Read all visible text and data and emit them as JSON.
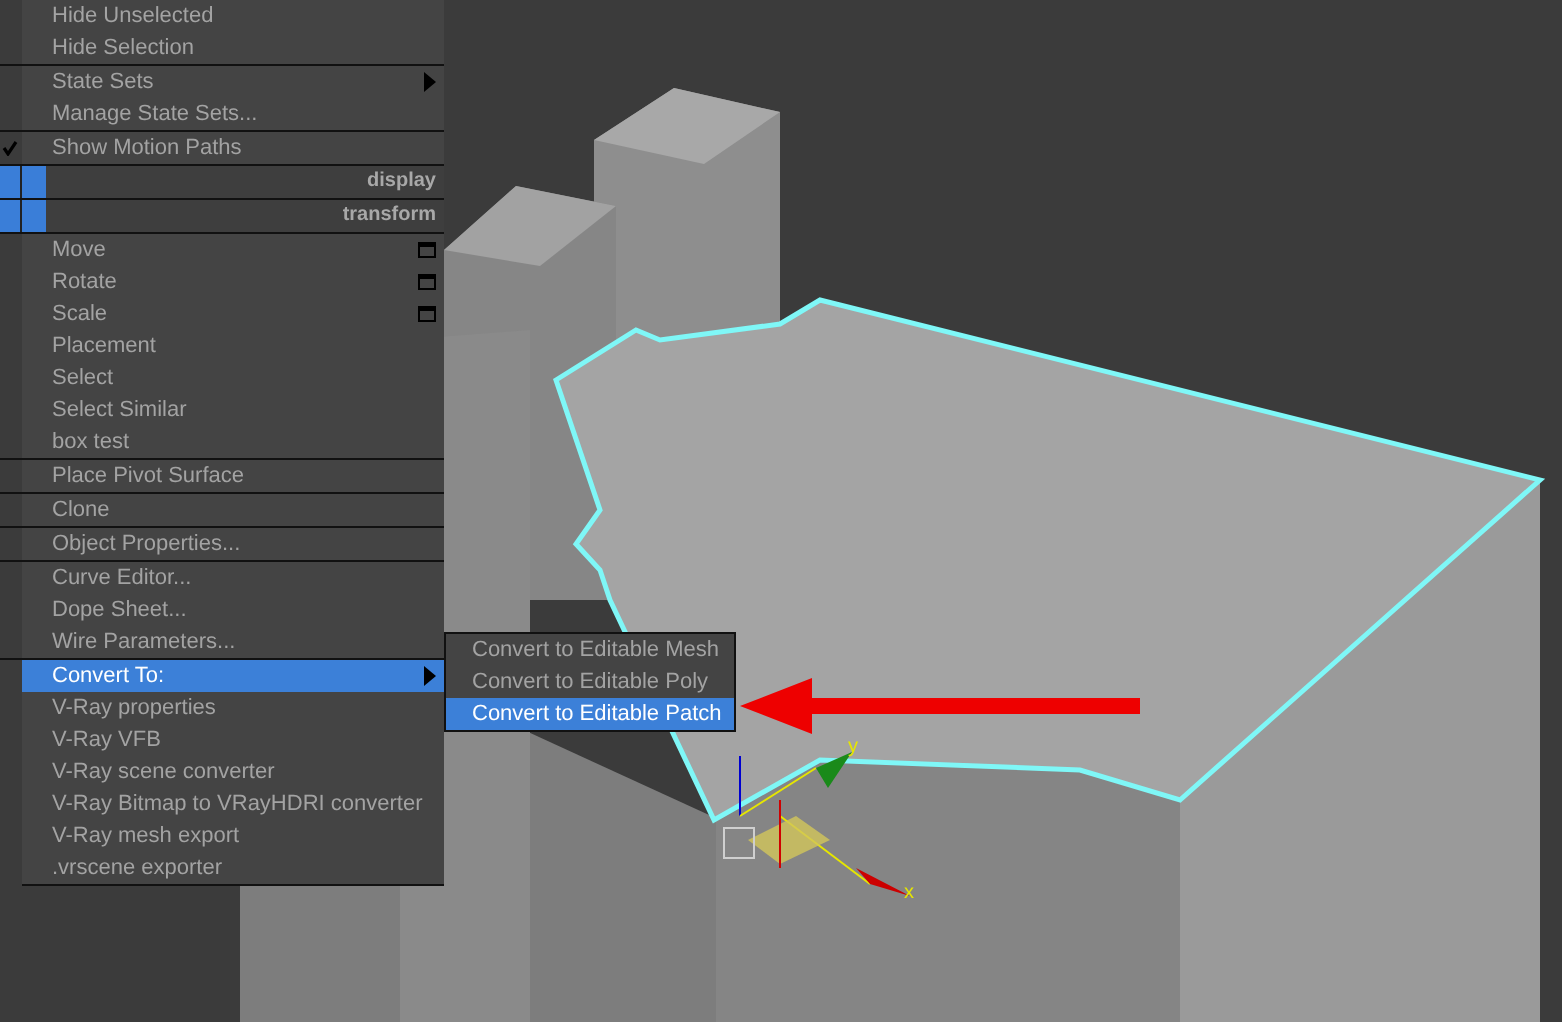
{
  "context_menu": {
    "groups": [
      {
        "items": [
          {
            "kind": "item",
            "label": "Hide Unselected",
            "has_submenu": false,
            "checked": false,
            "selected": false,
            "window_icon": false
          },
          {
            "kind": "item",
            "label": "Hide Selection",
            "has_submenu": false,
            "checked": false,
            "selected": false,
            "window_icon": false
          }
        ]
      },
      {
        "items": [
          {
            "kind": "item",
            "label": "State Sets",
            "has_submenu": true,
            "checked": false,
            "selected": false,
            "window_icon": false
          },
          {
            "kind": "item",
            "label": "Manage State Sets...",
            "has_submenu": false,
            "checked": false,
            "selected": false,
            "window_icon": false
          }
        ]
      },
      {
        "items": [
          {
            "kind": "item",
            "label": "Show Motion Paths",
            "has_submenu": false,
            "checked": true,
            "selected": false,
            "window_icon": false
          }
        ]
      },
      {
        "items": [
          {
            "kind": "header",
            "label": "display"
          }
        ]
      },
      {
        "items": [
          {
            "kind": "header",
            "label": "transform"
          }
        ]
      },
      {
        "items": [
          {
            "kind": "item",
            "label": "Move",
            "has_submenu": false,
            "checked": false,
            "selected": false,
            "window_icon": true
          },
          {
            "kind": "item",
            "label": "Rotate",
            "has_submenu": false,
            "checked": false,
            "selected": false,
            "window_icon": true
          },
          {
            "kind": "item",
            "label": "Scale",
            "has_submenu": false,
            "checked": false,
            "selected": false,
            "window_icon": true
          },
          {
            "kind": "item",
            "label": "Placement",
            "has_submenu": false,
            "checked": false,
            "selected": false,
            "window_icon": false
          },
          {
            "kind": "item",
            "label": "Select",
            "has_submenu": false,
            "checked": false,
            "selected": false,
            "window_icon": false
          },
          {
            "kind": "item",
            "label": "Select Similar",
            "has_submenu": false,
            "checked": false,
            "selected": false,
            "window_icon": false
          },
          {
            "kind": "item",
            "label": "box test",
            "has_submenu": false,
            "checked": false,
            "selected": false,
            "window_icon": false
          }
        ]
      },
      {
        "items": [
          {
            "kind": "item",
            "label": "Place Pivot Surface",
            "has_submenu": false,
            "checked": false,
            "selected": false,
            "window_icon": false
          }
        ]
      },
      {
        "items": [
          {
            "kind": "item",
            "label": "Clone",
            "has_submenu": false,
            "checked": false,
            "selected": false,
            "window_icon": false
          }
        ]
      },
      {
        "items": [
          {
            "kind": "item",
            "label": "Object Properties...",
            "has_submenu": false,
            "checked": false,
            "selected": false,
            "window_icon": false
          }
        ]
      },
      {
        "items": [
          {
            "kind": "item",
            "label": "Curve Editor...",
            "has_submenu": false,
            "checked": false,
            "selected": false,
            "window_icon": false
          },
          {
            "kind": "item",
            "label": "Dope Sheet...",
            "has_submenu": false,
            "checked": false,
            "selected": false,
            "window_icon": false
          },
          {
            "kind": "item",
            "label": "Wire Parameters...",
            "has_submenu": false,
            "checked": false,
            "selected": false,
            "window_icon": false
          }
        ]
      },
      {
        "items": [
          {
            "kind": "item",
            "label": "Convert To:",
            "has_submenu": true,
            "checked": false,
            "selected": true,
            "window_icon": false
          },
          {
            "kind": "item",
            "label": "V-Ray properties",
            "has_submenu": false,
            "checked": false,
            "selected": false,
            "window_icon": false
          },
          {
            "kind": "item",
            "label": "V-Ray VFB",
            "has_submenu": false,
            "checked": false,
            "selected": false,
            "window_icon": false
          },
          {
            "kind": "item",
            "label": "V-Ray scene converter",
            "has_submenu": false,
            "checked": false,
            "selected": false,
            "window_icon": false
          },
          {
            "kind": "item",
            "label": "V-Ray Bitmap to VRayHDRI converter",
            "has_submenu": false,
            "checked": false,
            "selected": false,
            "window_icon": false
          },
          {
            "kind": "item",
            "label": "V-Ray mesh export",
            "has_submenu": false,
            "checked": false,
            "selected": false,
            "window_icon": false
          },
          {
            "kind": "item",
            "label": ".vrscene exporter",
            "has_submenu": false,
            "checked": false,
            "selected": false,
            "window_icon": false
          }
        ]
      }
    ]
  },
  "submenu": {
    "items": [
      {
        "label": "Convert to Editable Mesh",
        "selected": false
      },
      {
        "label": "Convert to Editable Poly",
        "selected": false
      },
      {
        "label": "Convert to Editable Patch",
        "selected": true
      }
    ]
  },
  "gizmo": {
    "axes": [
      {
        "label": "y"
      },
      {
        "label": "x"
      }
    ]
  }
}
